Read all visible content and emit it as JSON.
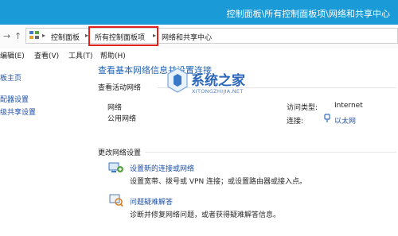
{
  "window": {
    "title": "控制面板\\所有控制面板项\\网络和共享中心"
  },
  "address_bar": {
    "crumbs": [
      "控制面板",
      "所有控制面板项",
      "网络和共享中心"
    ]
  },
  "menu": [
    "编辑(E)",
    "查看(V)",
    "工具(T)",
    "帮助(H)"
  ],
  "sidebar": {
    "items": [
      "板主页",
      "配器设置",
      "级共享设置"
    ]
  },
  "main": {
    "heading": "查看基本网络信息并设置连接",
    "active_networks_label": "查看活动网络",
    "network": {
      "name": "网络",
      "type": "公用网络",
      "access_type_label": "访问类型:",
      "access_type_value": "Internet",
      "connection_label": "连接:",
      "connection_value": "以太网"
    },
    "change_settings_label": "更改网络设置",
    "tasks": [
      {
        "link": "设置新的连接或网络",
        "description": "设置宽带、拨号或 VPN 连接；或设置路由器或接入点。",
        "icon": "network-setup-icon"
      },
      {
        "link": "问题疑难解答",
        "description": "诊断并修复网络问题，或者获得疑难解答信息。",
        "icon": "troubleshoot-icon"
      }
    ]
  },
  "watermark": {
    "text": "系统之家",
    "sub": "XITONGZHIJIA.NET"
  },
  "colors": {
    "titlebar": "#1a9ad6",
    "link": "#1f4fa4",
    "heading": "#1f62b4",
    "highlight": "#e0211c"
  }
}
